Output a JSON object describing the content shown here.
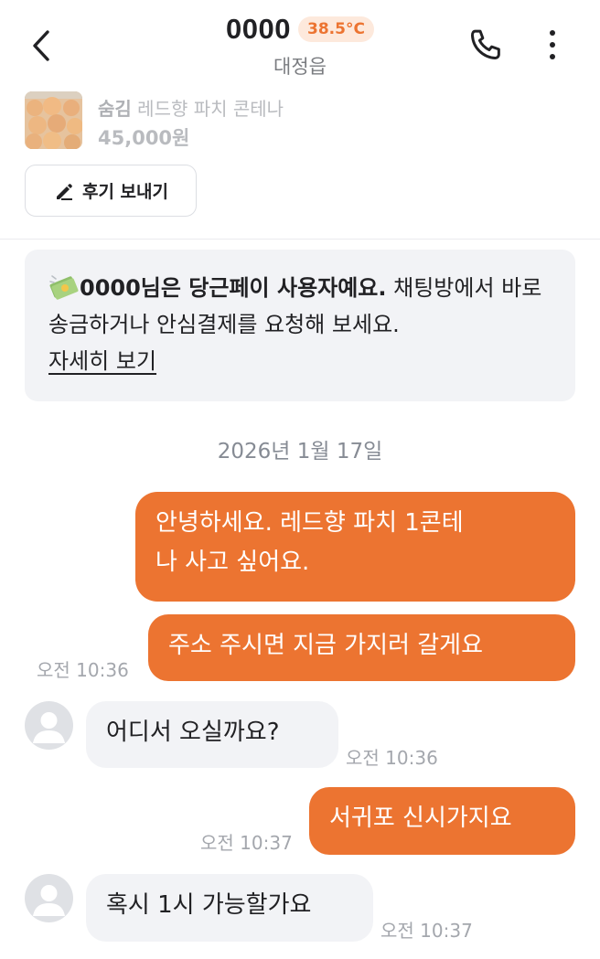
{
  "header": {
    "name": "0000",
    "temperature": "38.5°C",
    "location": "대정읍",
    "back_icon": "chevron-left-icon",
    "phone_icon": "phone-icon",
    "more_icon": "more-vertical-icon"
  },
  "product": {
    "status": "숨김",
    "title": "레드향 파치 콘테나",
    "price": "45,000원",
    "review_button": "후기 보내기"
  },
  "notice": {
    "bold": "0000님은 당근페이 사용자예요.",
    "text": " 채팅방에서 바로 송금하거나 안심결제를 요청해 보세요.",
    "link": "자세히 보기"
  },
  "date_separator": "2026년 1월 17일",
  "messages": [
    {
      "from": "me",
      "text_line1": "안녕하세요. 레드향 파치 1콘테",
      "text_line2": "나 사고 싶어요."
    },
    {
      "from": "me",
      "text": "주소 주시면 지금 가지러 갈게요",
      "time": "오전 10:36"
    },
    {
      "from": "other",
      "text": "어디서 오실까요?",
      "time": "오전 10:36"
    },
    {
      "from": "me",
      "text": "서귀포 신시가지요",
      "time": "오전 10:37"
    },
    {
      "from": "other",
      "text": "혹시 1시 가능할가요",
      "time": "오전 10:37"
    }
  ],
  "colors": {
    "accent": "#ec7431",
    "badge_bg": "#fde9dc",
    "bubble_in": "#f2f3f6",
    "muted_text": "#a4a7ad"
  }
}
